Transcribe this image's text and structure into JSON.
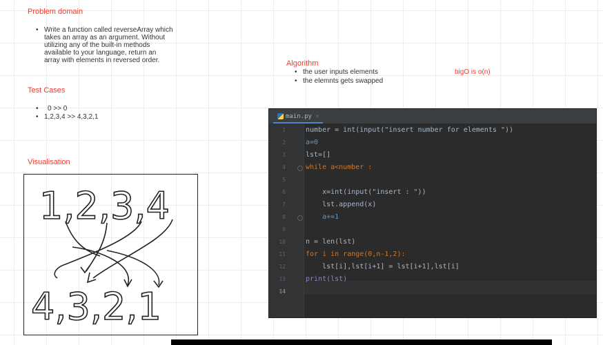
{
  "problem_domain": {
    "heading": "Problem domain",
    "text_lines": [
      "Write a function called reverseArray which",
      "takes an array as an argument. Without",
      "utilizing any of the built-in methods",
      "available to your language, return an",
      "array with elements in reversed order."
    ]
  },
  "test_cases": {
    "heading": "Test Cases",
    "items": [
      "0 >> 0",
      "1,2,3,4 >> 4,3,2,1"
    ]
  },
  "visualisation": {
    "heading": "Visualisation",
    "top_row": "1,2,3,4",
    "bottom_row": "4,3,2,1"
  },
  "algorithm": {
    "heading": "Algorithm",
    "items": [
      "the user inputs elements",
      "the elemnts gets swapped"
    ]
  },
  "bigo": "bigO is o(n)",
  "editor": {
    "tab_label": "main.py",
    "line_numbers": [
      "1",
      "2",
      "3",
      "4",
      "5",
      "6",
      "7",
      "8",
      "9",
      "10",
      "11",
      "12",
      "13",
      "14"
    ],
    "code_lines": [
      "number = int(input(\"insert number for elements \"))",
      "a=0",
      "lst=[]",
      "while a<number :",
      "",
      "    x=int(input(\"insert : \"))",
      "    lst.append(x)",
      "    a+=1",
      "",
      "n = len(lst)",
      "for i in range(0,n-1,2):",
      "    lst[i],lst[i+1] = lst[i+1],lst[i]",
      "print(lst)",
      ""
    ]
  },
  "colors": {
    "accent_red": "#ef3b2d",
    "editor_bg": "#2b2b2b",
    "keyword": "#cc7832",
    "string": "#6a8759",
    "number": "#6897bb"
  }
}
